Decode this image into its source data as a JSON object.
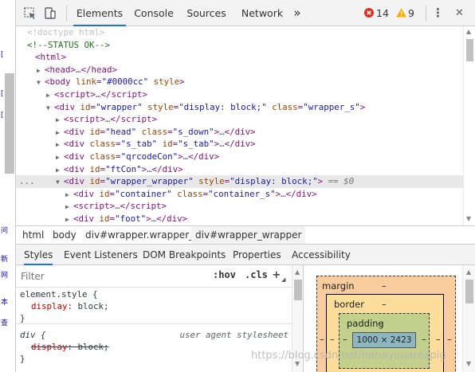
{
  "page": {
    "fragments": [
      "[",
      "[",
      "[",
      "问",
      "新",
      "网",
      "本",
      "查"
    ]
  },
  "toolbar": {
    "tabs": [
      "Elements",
      "Console",
      "Sources",
      "Network"
    ],
    "more": "»",
    "error_count": "14",
    "warning_count": "9",
    "menu": "⋮",
    "close": "✕"
  },
  "tree": {
    "rows": [
      {
        "type": "doctype",
        "indent": 0,
        "text": "<!doctype html>"
      },
      {
        "type": "comment",
        "indent": 0,
        "text": "<!--STATUS OK-->"
      },
      {
        "type": "open",
        "indent": 0,
        "tri": "",
        "tag": "html",
        "attrs": [],
        "tail": ""
      },
      {
        "type": "collapsed",
        "indent": 1,
        "tri": "▶",
        "tag": "head",
        "attrs": []
      },
      {
        "type": "open",
        "indent": 1,
        "tri": "▼",
        "tag": "body",
        "attrs": [
          [
            "link",
            "#0000cc"
          ],
          [
            "style",
            null
          ]
        ],
        "tail": ""
      },
      {
        "type": "collapsed",
        "indent": 2,
        "tri": "▶",
        "tag": "script",
        "attrs": []
      },
      {
        "type": "open",
        "indent": 2,
        "tri": "▼",
        "tag": "div",
        "attrs": [
          [
            "id",
            "wrapper"
          ],
          [
            "style",
            "display: block;"
          ],
          [
            "class",
            "wrapper_s"
          ]
        ],
        "tail": ""
      },
      {
        "type": "collapsed",
        "indent": 3,
        "tri": "▶",
        "tag": "script",
        "attrs": []
      },
      {
        "type": "collapsed",
        "indent": 3,
        "tri": "▶",
        "tag": "div",
        "attrs": [
          [
            "id",
            "head"
          ],
          [
            "class",
            "s_down"
          ]
        ]
      },
      {
        "type": "collapsed",
        "indent": 3,
        "tri": "▶",
        "tag": "div",
        "attrs": [
          [
            "class",
            "s_tab"
          ],
          [
            "id",
            "s_tab"
          ]
        ]
      },
      {
        "type": "collapsed",
        "indent": 3,
        "tri": "▶",
        "tag": "div",
        "attrs": [
          [
            "class",
            "qrcodeCon"
          ]
        ]
      },
      {
        "type": "collapsed",
        "indent": 3,
        "tri": "▶",
        "tag": "div",
        "attrs": [
          [
            "id",
            "ftCon"
          ]
        ]
      },
      {
        "type": "open",
        "indent": 3,
        "tri": "▼",
        "tag": "div",
        "attrs": [
          [
            "id",
            "wrapper_wrapper"
          ],
          [
            "style",
            "display: block;"
          ]
        ],
        "tail": " == $0",
        "selected": true
      },
      {
        "type": "collapsed",
        "indent": 4,
        "tri": "▶",
        "tag": "div",
        "attrs": [
          [
            "id",
            "container"
          ],
          [
            "class",
            "container_s"
          ]
        ]
      },
      {
        "type": "collapsed",
        "indent": 4,
        "tri": "▶",
        "tag": "script",
        "attrs": []
      },
      {
        "type": "collapsed",
        "indent": 4,
        "tri": "▶",
        "tag": "div",
        "attrs": [
          [
            "id",
            "foot"
          ]
        ]
      }
    ],
    "selected_dots": "..."
  },
  "breadcrumb": [
    "html",
    "body",
    "div#wrapper.wrapper_s",
    "div#wrapper_wrapper"
  ],
  "subtabs": [
    "Styles",
    "Event Listeners",
    "DOM Breakpoints",
    "Properties",
    "Accessibility"
  ],
  "styles": {
    "filter_placeholder": "Filter",
    "hov": ":hov",
    "cls": ".cls",
    "plus": "+",
    "element_style": {
      "selector": "element.style {",
      "prop": "display",
      "value": "block;",
      "close": "}"
    },
    "ua_rule": {
      "selector": "div {",
      "source": "user agent stylesheet",
      "prop": "display",
      "value": "block;",
      "close": "}"
    }
  },
  "box_model": {
    "margin_label": "margin",
    "margin_value": "–",
    "border_label": "border",
    "border_value": "–",
    "padding_label": "padding",
    "padding_value": "–",
    "content": "1000 × 2423",
    "side_value": "–"
  },
  "watermark": "https://blog.csdn.net/hahayouareapig"
}
